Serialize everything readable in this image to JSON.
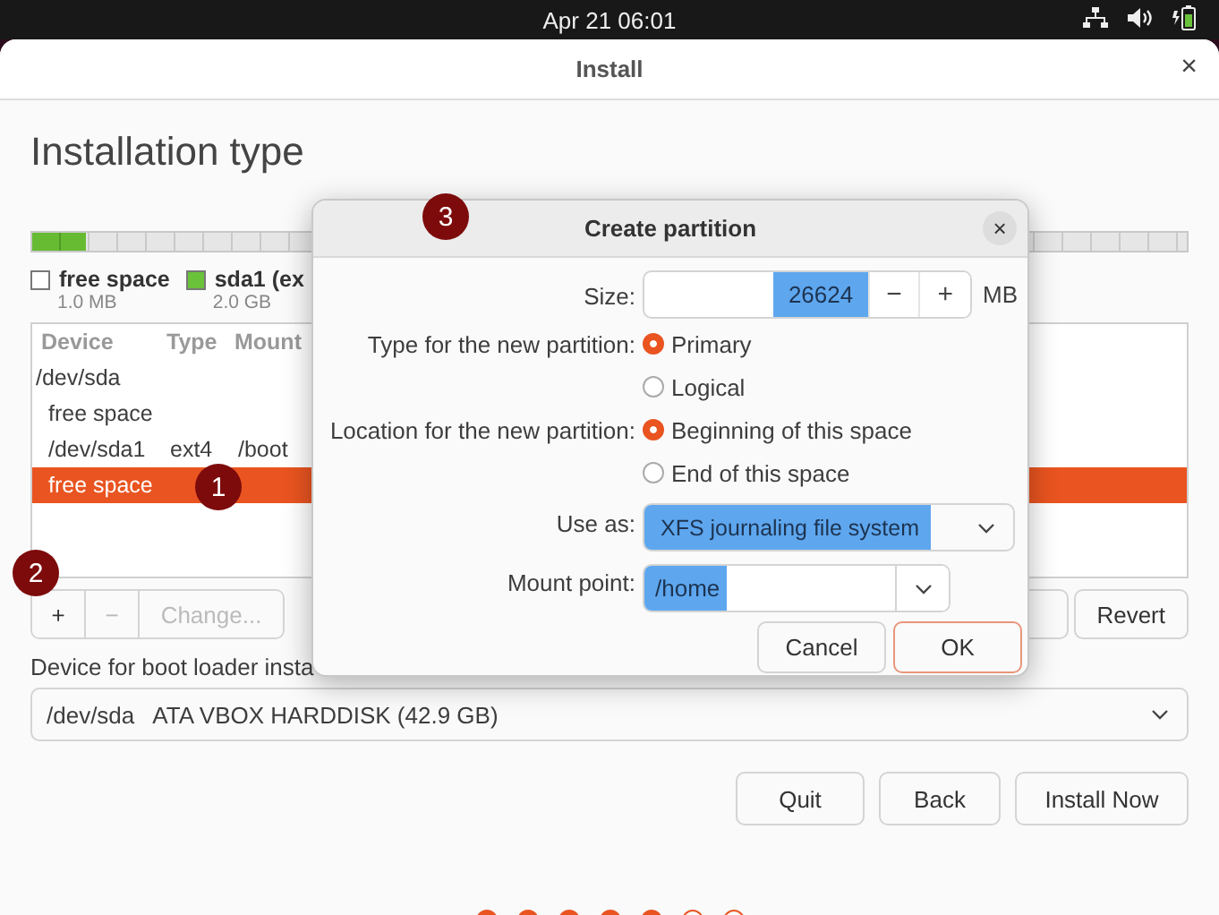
{
  "top_bar": {
    "clock": "Apr 21  06:01"
  },
  "window": {
    "title": "Install",
    "close": "×"
  },
  "heading": "Installation type",
  "partition_bar": {
    "level": 0.047
  },
  "legend": [
    {
      "name": "free space",
      "size": "1.0 MB",
      "color": "#ffffff"
    },
    {
      "name": "sda1 (ex",
      "size": "2.0 GB",
      "color": "#6ac13a"
    }
  ],
  "table": {
    "columns": [
      "Device",
      "Type",
      "Mount"
    ],
    "rows": [
      {
        "device": "/dev/sda",
        "selected": false,
        "children": [
          {
            "device": "free space",
            "selected": false
          },
          {
            "device": "/dev/sda1",
            "type": "ext4",
            "mount": "/boot",
            "selected": false
          },
          {
            "device": "free space",
            "selected": true
          }
        ]
      }
    ]
  },
  "table_buttons": [
    {
      "label": "+",
      "disabled": false
    },
    {
      "label": "−",
      "disabled": true
    },
    {
      "label": "Change...",
      "disabled": true
    }
  ],
  "revert_button": "Revert",
  "boot_loader": {
    "label": "Device for boot loader insta",
    "device": "/dev/sda",
    "description": "ATA VBOX HARDDISK (42.9 GB)"
  },
  "buttons": [
    "Quit",
    "Back",
    "Install Now"
  ],
  "steps": [
    {
      "done": true
    },
    {
      "done": true
    },
    {
      "done": true
    },
    {
      "done": true
    },
    {
      "done": true
    },
    {
      "done": false
    },
    {
      "done": false
    }
  ],
  "dialog": {
    "title": "Create partition",
    "close": "×",
    "size": {
      "label": "Size:",
      "value": "26624",
      "minus": "−",
      "plus": "+",
      "unit": "MB"
    },
    "radio_groups": [
      {
        "label": "Type for the new partition:",
        "options": [
          {
            "label": "Primary",
            "selected": true
          },
          {
            "label": "Logical",
            "selected": false
          }
        ]
      },
      {
        "label": "Location for the new partition:",
        "options": [
          {
            "label": "Beginning of this space",
            "selected": true
          },
          {
            "label": "End of this space",
            "selected": false
          }
        ]
      }
    ],
    "use_as": {
      "label": "Use as:",
      "value": "XFS journaling file system"
    },
    "mount_point": {
      "label": "Mount point:",
      "value": "/home"
    },
    "buttons": [
      {
        "label": "Cancel",
        "default": false
      },
      {
        "label": "OK",
        "default": true
      }
    ]
  },
  "markers": [
    "1",
    "2",
    "3"
  ]
}
